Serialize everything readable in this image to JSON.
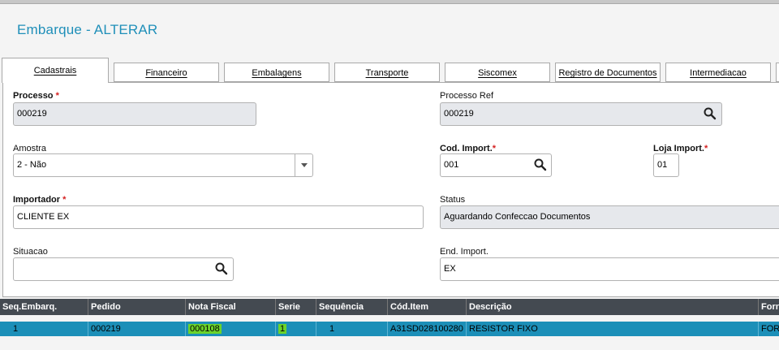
{
  "header": {
    "title": "Embarque - ALTERAR"
  },
  "tabs": [
    {
      "label": "Cadastrais"
    },
    {
      "label": "Financeiro"
    },
    {
      "label": "Embalagens"
    },
    {
      "label": "Transporte"
    },
    {
      "label": "Siscomex"
    },
    {
      "label": "Registro de Documentos"
    },
    {
      "label": "Intermediacao"
    }
  ],
  "form": {
    "processo": {
      "label": "Processo",
      "value": "000219"
    },
    "processo_ref": {
      "label": "Processo Ref",
      "value": "000219"
    },
    "amostra": {
      "label": "Amostra",
      "value": "2 - Não"
    },
    "cod_import": {
      "label": "Cod. Import.",
      "value": "001"
    },
    "loja_import": {
      "label": "Loja Import.",
      "value": "01"
    },
    "importador": {
      "label": "Importador",
      "value": "CLIENTE EX"
    },
    "status": {
      "label": "Status",
      "value": "Aguardando Confeccao Documentos"
    },
    "situacao": {
      "label": "Situacao",
      "value": ""
    },
    "end_import": {
      "label": "End. Import.",
      "value": "EX"
    },
    "required_marker": "*"
  },
  "grid": {
    "columns": [
      "Seq.Embarq.",
      "Pedido",
      "Nota Fiscal",
      "Serie",
      "Sequência",
      "Cód.Item",
      "Descrição",
      "Forn"
    ],
    "rows": [
      {
        "seq": "1",
        "pedido": "000219",
        "nota_fiscal": "000108",
        "serie": "1",
        "sequencia": "1",
        "cod_item": "A31SD028100280",
        "descricao": "RESISTOR FIXO",
        "forn": "FOR"
      }
    ]
  },
  "icons": {
    "search": "search-icon",
    "dropdown": "caret-down-icon"
  },
  "colors": {
    "title": "#1f8fb9",
    "grid_header": "#444a51",
    "selected_row": "#1c8fb8",
    "highlight": "#6bd32b",
    "required": "#d42020"
  }
}
